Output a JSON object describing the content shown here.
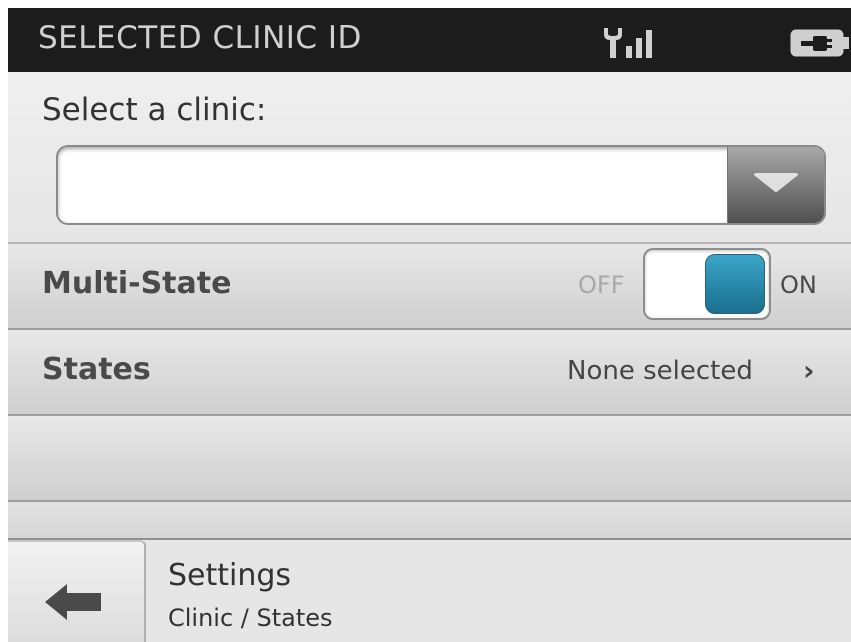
{
  "status_bar": {
    "title": "SELECTED CLINIC ID",
    "signal_icon": "signal-strength-icon",
    "battery_icon": "battery-charging-icon"
  },
  "clinic_select": {
    "label": "Select a clinic:",
    "value": "",
    "arrow_icon": "chevron-down-icon"
  },
  "multi_state": {
    "label": "Multi-State",
    "off_label": "OFF",
    "on_label": "ON",
    "state": "on",
    "accent": "#2a8fb3"
  },
  "states": {
    "label": "States",
    "value": "None selected",
    "chevron": "›"
  },
  "footer": {
    "back_icon": "arrow-left-icon",
    "title": "Settings",
    "subtitle": "Clinic / States"
  }
}
